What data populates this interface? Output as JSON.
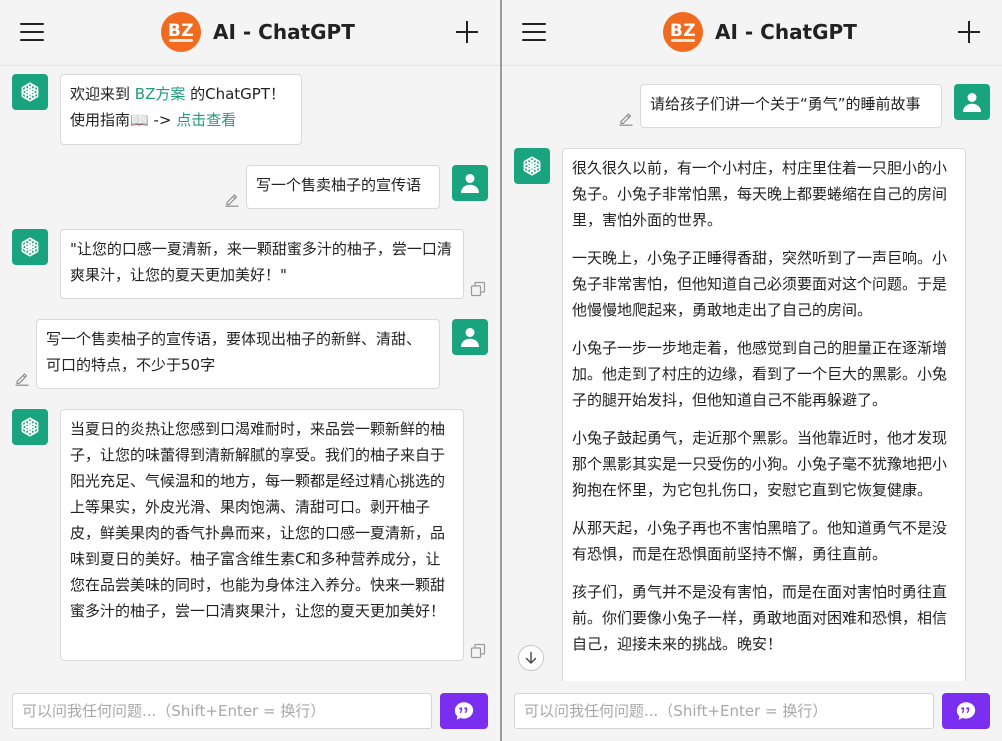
{
  "left": {
    "header": {
      "logo_text": "BZ",
      "title": "AI - ChatGPT"
    },
    "messages": {
      "welcome": {
        "line1_prefix": "欢迎来到 ",
        "brand_link": "BZ方案",
        "line1_suffix": " 的ChatGPT！",
        "line2_prefix": "使用指南📖 -> ",
        "guide_link": "点击查看"
      },
      "user1": "写一个售卖柚子的宣传语",
      "ai1": "\"让您的口感一夏清新，来一颗甜蜜多汁的柚子，尝一口清爽果汁，让您的夏天更加美好！\"",
      "user2": "写一个售卖柚子的宣传语，要体现出柚子的新鲜、清甜、可口的特点，不少于50字",
      "ai2": "当夏日的炎热让您感到口渴难耐时，来品尝一颗新鲜的柚子，让您的味蕾得到清新解腻的享受。我们的柚子来自于阳光充足、气候温和的地方，每一颗都是经过精心挑选的上等果实，外皮光滑、果肉饱满、清甜可口。剥开柚子皮，鲜美果肉的香气扑鼻而来，让您的口感一夏清新，品味到夏日的美好。柚子富含维生素C和多种营养成分，让您在品尝美味的同时，也能为身体注入养分。快来一颗甜蜜多汁的柚子，尝一口清爽果汁，让您的夏天更加美好！"
    },
    "input": {
      "placeholder": "可以问我任何问题...（Shift+Enter = 换行）"
    }
  },
  "right": {
    "header": {
      "logo_text": "BZ",
      "title": "AI - ChatGPT"
    },
    "messages": {
      "user1": "请给孩子们讲一个关于“勇气”的睡前故事",
      "story": [
        "很久很久以前，有一个小村庄，村庄里住着一只胆小的小兔子。小兔子非常怕黑，每天晚上都要蜷缩在自己的房间里，害怕外面的世界。",
        "一天晚上，小兔子正睡得香甜，突然听到了一声巨响。小兔子非常害怕，但他知道自己必须要面对这个问题。于是他慢慢地爬起来，勇敢地走出了自己的房间。",
        "小兔子一步一步地走着，他感觉到自己的胆量正在逐渐增加。他走到了村庄的边缘，看到了一个巨大的黑影。小兔子的腿开始发抖，但他知道自己不能再躲避了。",
        "小兔子鼓起勇气，走近那个黑影。当他靠近时，他才发现那个黑影其实是一只受伤的小狗。小兔子毫不犹豫地把小狗抱在怀里，为它包扎伤口，安慰它直到它恢复健康。",
        "从那天起，小兔子再也不害怕黑暗了。他知道勇气不是没有恐惧，而是在恐惧面前坚持不懈，勇往直前。",
        "孩子们，勇气并不是没有害怕，而是在面对害怕时勇往直前。你们要像小兔子一样，勇敢地面对困难和恐惧，相信自己，迎接未来的挑战。晚安！"
      ]
    },
    "input": {
      "placeholder": "可以问我任何问题...（Shift+Enter = 换行）"
    }
  },
  "colors": {
    "accent": "#19a47f",
    "send": "#7a2ff0",
    "logo": "#f06a1f",
    "link": "#1f9c79"
  },
  "icons": {
    "menu": "hamburger-icon",
    "new_chat": "plus-icon",
    "bot": "openai-logo-icon",
    "user": "user-icon",
    "edit": "pencil-icon",
    "copy": "copy-icon",
    "send": "chat-bubble-icon",
    "scroll": "arrow-down-icon"
  }
}
